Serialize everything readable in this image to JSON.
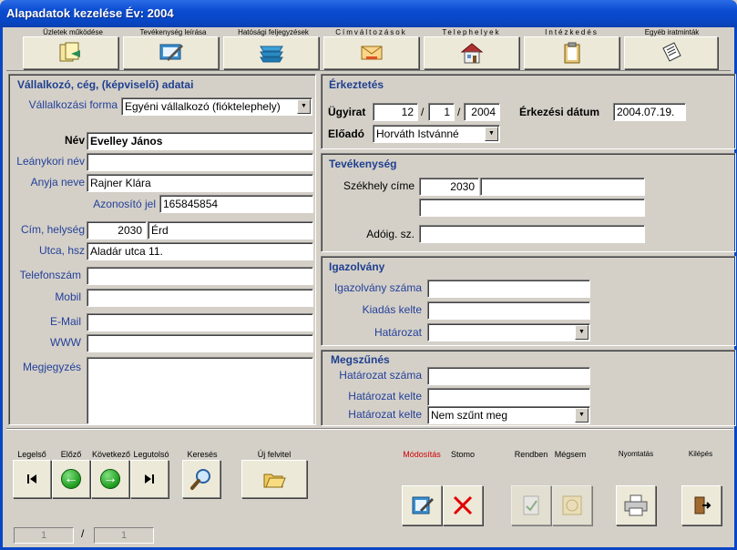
{
  "window": {
    "title": "Alapadatok kezelése Év: 2004"
  },
  "toolbar": [
    {
      "label": "Üzletek működése",
      "icon": "documents-icon"
    },
    {
      "label": "Tevékenység leírása",
      "icon": "edit-document-icon"
    },
    {
      "label": "Hatósági feljegyzések",
      "icon": "stacked-trays-icon"
    },
    {
      "label": "Címváltozások",
      "icon": "envelope-icon"
    },
    {
      "label": "Telephelyek",
      "icon": "house-icon"
    },
    {
      "label": "Intézkedés",
      "icon": "clipboard-icon"
    },
    {
      "label": "Egyéb iratminták",
      "icon": "papers-icon"
    }
  ],
  "left": {
    "section_title": "Vállalkozó, cég, (képviselő) adatai",
    "forma_label": "Vállalkozási forma",
    "forma_value": "Egyéni vállalkozó (fióktelephely)",
    "nev_label": "Név",
    "nev_value": "Evelley János",
    "leanykori_label": "Leánykori név",
    "leanykori_value": "",
    "anyja_label": "Anyja neve",
    "anyja_value": "Rajner Klára",
    "azonosito_label": "Azonosító jel",
    "azonosito_value": "165845854",
    "cim_label": "Cím, helység",
    "irsz_value": "2030",
    "helyseg_value": "Érd",
    "utca_label": "Utca, hsz",
    "utca_value": "Aladár utca 11.",
    "telefon_label": "Telefonszám",
    "telefon_value": "",
    "mobil_label": "Mobil",
    "mobil_value": "",
    "email_label": "E-Mail",
    "email_value": "",
    "www_label": "WWW",
    "www_value": "",
    "megj_label": "Megjegyzés",
    "megj_value": ""
  },
  "erkeztetes": {
    "title": "Érkeztetés",
    "ugyirat_label": "Ügyirat",
    "ugyirat_1": "12",
    "sep": "/",
    "ugyirat_2": "1",
    "ugyirat_3": "2004",
    "datum_label": "Érkezési dátum",
    "datum_value": "2004.07.19.",
    "eloado_label": "Előadó",
    "eloado_value": "Horváth Istvánné"
  },
  "tevekenyseg": {
    "title": "Tevékenység",
    "szekhely_label": "Székhely címe",
    "szekhely_irsz": "2030",
    "szekhely_varos": "",
    "szekhely_utca": "",
    "adoig_label": "Adóig. sz.",
    "adoig_value": ""
  },
  "igazolvany": {
    "title": "Igazolvány",
    "szam_label": "Igazolvány száma",
    "szam_value": "",
    "kelte_label": "Kiadás kelte",
    "kelte_value": "",
    "hat_label": "Határozat",
    "hat_value": ""
  },
  "megszunes": {
    "title": "Megszűnés",
    "szam_label": "Határozat száma",
    "szam_value": "",
    "kelte_label": "Határozat kelte",
    "kelte_value": "",
    "kelte2_label": "Határozat kelte",
    "kelte2_value": "Nem szűnt meg"
  },
  "nav": {
    "legelso": "Legelső",
    "elozo": "Előző",
    "kovetkezo": "Következő",
    "legutolso": "Legutolsó",
    "kereses": "Keresés",
    "uj": "Új felvitel",
    "modositas": "Módosítás",
    "storno": "Stomo",
    "rendben": "Rendben",
    "megsem": "Mégsem",
    "nyomtatas": "Nyomtatás",
    "kilepes": "Kilépés"
  },
  "record": {
    "current": "1",
    "sep": "/",
    "total": "1"
  },
  "colors": {
    "title_bar": "#0846c4",
    "window_bg": "#d4d0c8",
    "label_blue": "#24409a",
    "storno_red": "#e00000"
  }
}
